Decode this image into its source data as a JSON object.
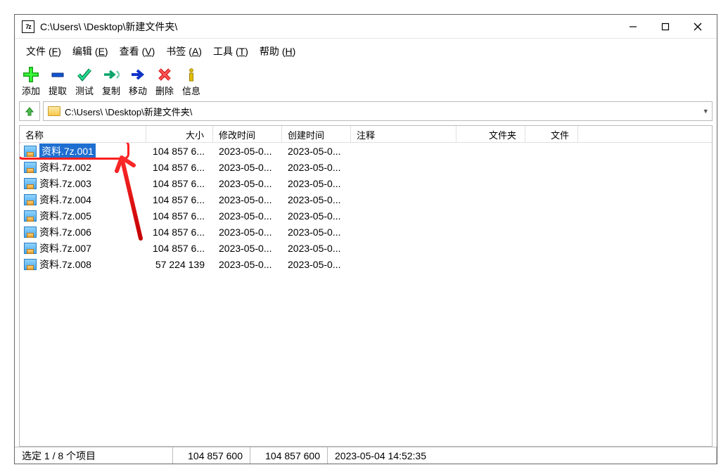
{
  "window": {
    "title": "C:\\Users\\        \\Desktop\\新建文件夹\\"
  },
  "menu": {
    "file": {
      "label": "文件",
      "key": "F"
    },
    "edit": {
      "label": "编辑",
      "key": "E"
    },
    "view": {
      "label": "查看",
      "key": "V"
    },
    "bookmark": {
      "label": "书签",
      "key": "A"
    },
    "tools": {
      "label": "工具",
      "key": "T"
    },
    "help": {
      "label": "帮助",
      "key": "H"
    }
  },
  "toolbar": {
    "add": "添加",
    "extract": "提取",
    "test": "测试",
    "copy": "复制",
    "move": "移动",
    "delete": "删除",
    "info": "信息"
  },
  "address": {
    "path": "C:\\Users\\         \\Desktop\\新建文件夹\\"
  },
  "columns": {
    "name": "名称",
    "size": "大小",
    "modified": "修改时间",
    "created": "创建时间",
    "comment": "注释",
    "folders": "文件夹",
    "files": "文件"
  },
  "files": [
    {
      "name": "资料.7z.001",
      "size": "104 857 6...",
      "modified": "2023-05-0...",
      "created": "2023-05-0...",
      "selected": true
    },
    {
      "name": "资料.7z.002",
      "size": "104 857 6...",
      "modified": "2023-05-0...",
      "created": "2023-05-0..."
    },
    {
      "name": "资料.7z.003",
      "size": "104 857 6...",
      "modified": "2023-05-0...",
      "created": "2023-05-0..."
    },
    {
      "name": "资料.7z.004",
      "size": "104 857 6...",
      "modified": "2023-05-0...",
      "created": "2023-05-0..."
    },
    {
      "name": "资料.7z.005",
      "size": "104 857 6...",
      "modified": "2023-05-0...",
      "created": "2023-05-0..."
    },
    {
      "name": "资料.7z.006",
      "size": "104 857 6...",
      "modified": "2023-05-0...",
      "created": "2023-05-0..."
    },
    {
      "name": "资料.7z.007",
      "size": "104 857 6...",
      "modified": "2023-05-0...",
      "created": "2023-05-0..."
    },
    {
      "name": "资料.7z.008",
      "size": "57 224 139",
      "modified": "2023-05-0...",
      "created": "2023-05-0..."
    }
  ],
  "status": {
    "selection": "选定 1 / 8 个项目",
    "size1": "104 857 600",
    "size2": "104 857 600",
    "datetime": "2023-05-04 14:52:35"
  },
  "annotation": {
    "highlight_file_index": 0
  }
}
